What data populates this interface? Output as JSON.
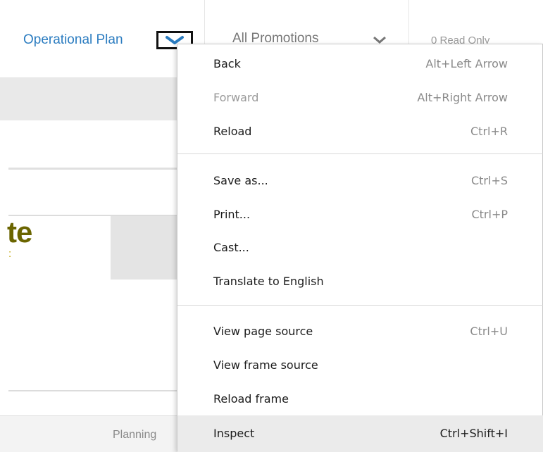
{
  "app": {
    "operational_plan": "Operational Plan",
    "all_promotions": "All Promotions",
    "read_only": "0 Read Only",
    "fragment_big": "te",
    "fragment_small": ":",
    "planning_tab": "Planning"
  },
  "context_menu": {
    "items": [
      {
        "label": "Back",
        "shortcut": "Alt+Left Arrow"
      },
      {
        "label": "Forward",
        "shortcut": "Alt+Right Arrow"
      },
      {
        "label": "Reload",
        "shortcut": "Ctrl+R"
      },
      {
        "label": "Save as...",
        "shortcut": "Ctrl+S"
      },
      {
        "label": "Print...",
        "shortcut": "Ctrl+P"
      },
      {
        "label": "Cast...",
        "shortcut": ""
      },
      {
        "label": "Translate to English",
        "shortcut": ""
      },
      {
        "label": "View page source",
        "shortcut": "Ctrl+U"
      },
      {
        "label": "View frame source",
        "shortcut": ""
      },
      {
        "label": "Reload frame",
        "shortcut": ""
      },
      {
        "label": "Inspect",
        "shortcut": "Ctrl+Shift+I"
      }
    ],
    "disabled_item": "Forward",
    "highlighted_item": "Inspect"
  },
  "colors": {
    "link_blue": "#2b7cc0",
    "highlight_row": "#ebebeb"
  }
}
